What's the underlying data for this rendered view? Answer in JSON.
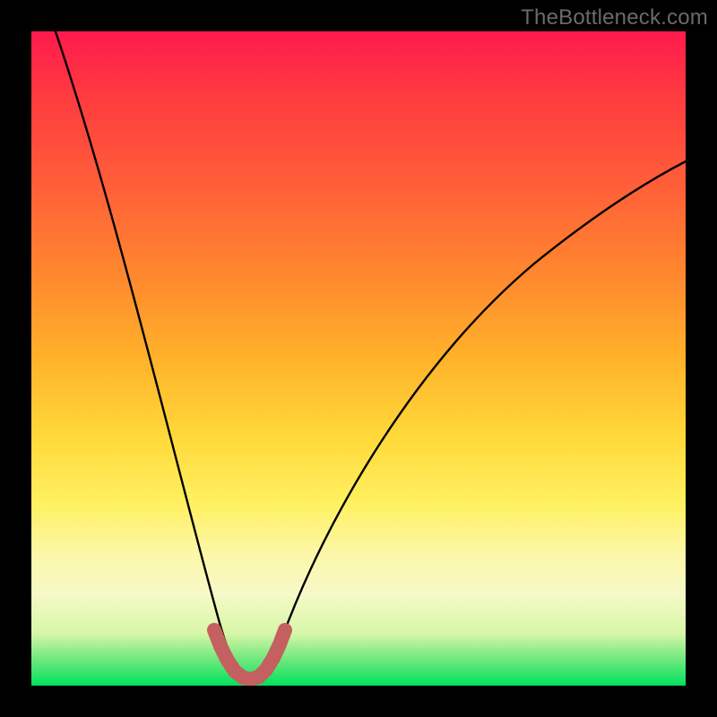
{
  "watermark": "TheBottleneck.com",
  "colors": {
    "background": "#000000",
    "gradient_top": "#ff1a4d",
    "gradient_bottom": "#00e25e",
    "curve": "#000000",
    "marker": "#c46060"
  },
  "chart_data": {
    "type": "line",
    "title": "",
    "xlabel": "",
    "ylabel": "",
    "xlim": [
      0,
      100
    ],
    "ylim": [
      0,
      100
    ],
    "series": [
      {
        "name": "bottleneck-curve",
        "x": [
          0,
          2,
          4,
          6,
          8,
          10,
          12,
          14,
          16,
          18,
          20,
          22,
          24,
          26,
          28,
          30,
          32,
          34,
          36,
          38,
          42,
          46,
          50,
          55,
          60,
          65,
          70,
          75,
          80,
          85,
          90,
          95,
          100
        ],
        "y": [
          100,
          93,
          86,
          79,
          72,
          65,
          58,
          51,
          44,
          37,
          30,
          23,
          16,
          10,
          5,
          1,
          0,
          0,
          1,
          4,
          12,
          20,
          28,
          36,
          43,
          50,
          56,
          61,
          66,
          70,
          74,
          77,
          80
        ]
      }
    ],
    "markers": {
      "name": "highlight-band",
      "x": [
        27.5,
        28.5,
        29.5,
        30.5,
        31.5,
        32.5,
        33.5,
        34.5,
        35.5,
        36.5,
        37.5
      ],
      "y": [
        7.5,
        5,
        3,
        1.5,
        0.8,
        0.5,
        0.8,
        1.5,
        3,
        5,
        7.5
      ]
    }
  }
}
